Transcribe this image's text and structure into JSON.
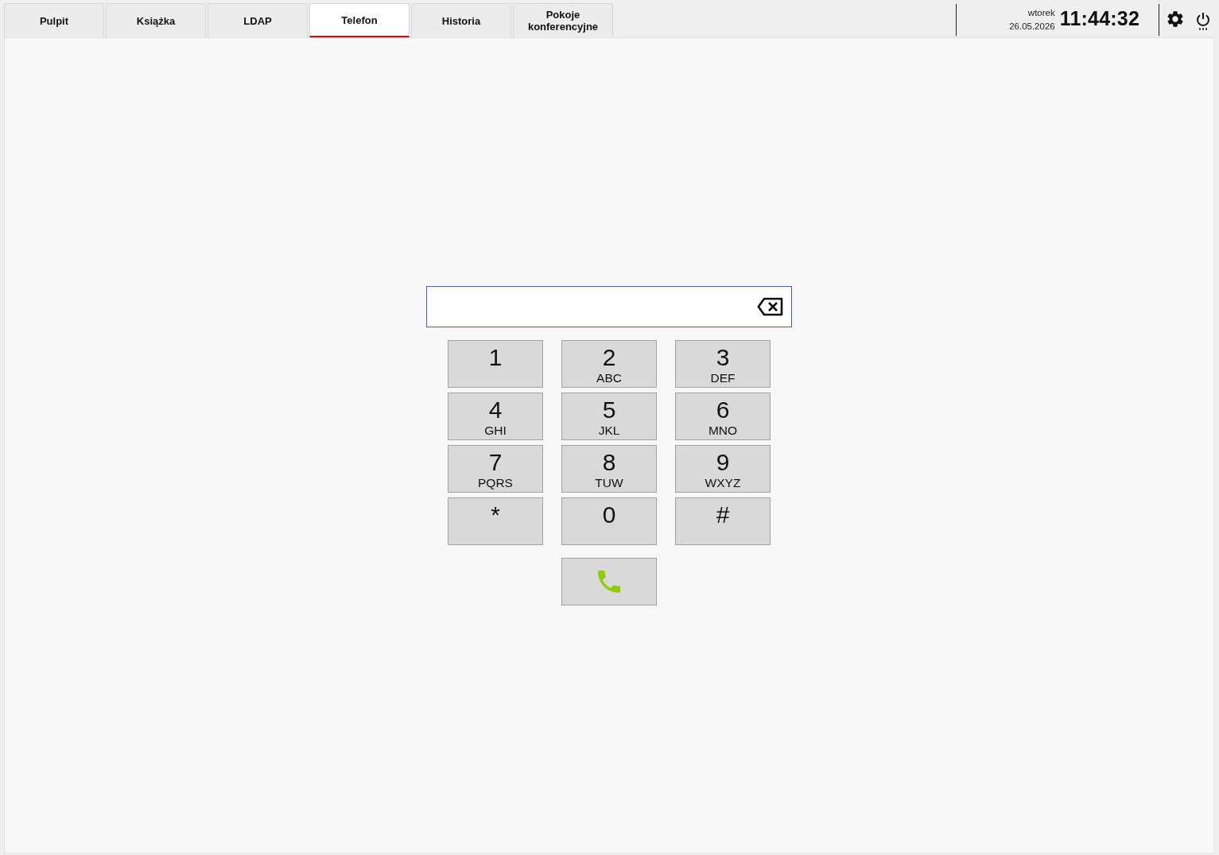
{
  "tabs": [
    {
      "label": "Pulpit",
      "selected": false
    },
    {
      "label": "Książka",
      "selected": false
    },
    {
      "label": "LDAP",
      "selected": false
    },
    {
      "label": "Telefon",
      "selected": true
    },
    {
      "label": "Historia",
      "selected": false
    },
    {
      "label": "Pokoje konferencyjne",
      "selected": false
    }
  ],
  "clock": {
    "weekday": "wtorek",
    "date": "26.05.2026",
    "time": "11:44:32"
  },
  "keypad": [
    {
      "digit": "1"
    },
    {
      "digit": "2",
      "letters": "ABC"
    },
    {
      "digit": "3",
      "letters": "DEF"
    },
    {
      "digit": "4",
      "letters": "GHI"
    },
    {
      "digit": "5",
      "letters": "JKL"
    },
    {
      "digit": "6",
      "letters": "MNO"
    },
    {
      "digit": "7",
      "letters": "PQRS"
    },
    {
      "digit": "8",
      "letters": "TUW"
    },
    {
      "digit": "9",
      "letters": "WXYZ"
    },
    {
      "digit": "*"
    },
    {
      "digit": "0"
    },
    {
      "digit": "#"
    }
  ]
}
